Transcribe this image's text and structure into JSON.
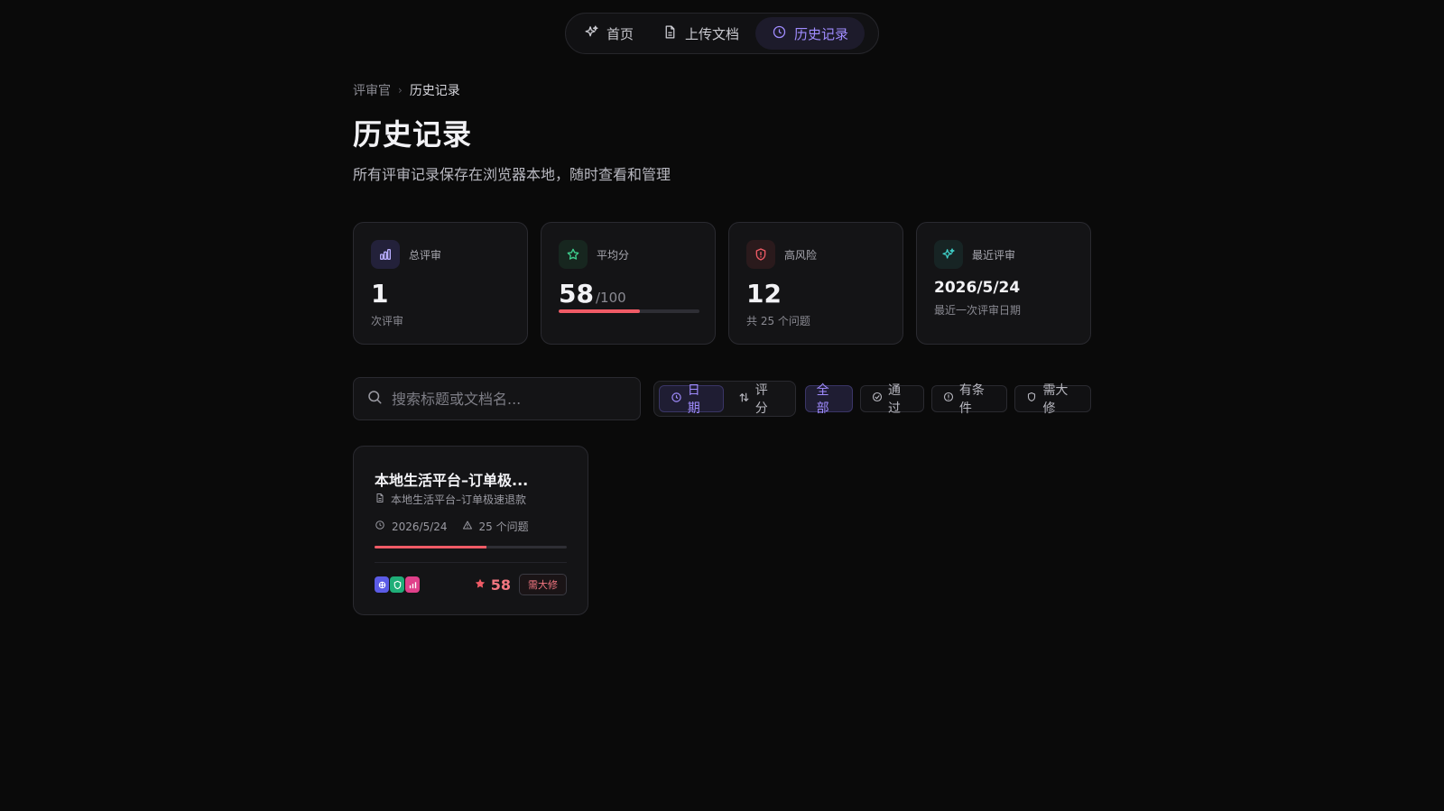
{
  "nav": {
    "items": [
      {
        "label": "首页",
        "icon": "sparkles-icon"
      },
      {
        "label": "上传文档",
        "icon": "document-icon"
      },
      {
        "label": "历史记录",
        "icon": "clock-icon",
        "active": true
      }
    ]
  },
  "breadcrumb": {
    "root": "评审官",
    "separator": "›",
    "current": "历史记录"
  },
  "page": {
    "title": "历史记录",
    "subtitle": "所有评审记录保存在浏览器本地，随时查看和管理"
  },
  "stats": {
    "total": {
      "label": "总评审",
      "value": "1",
      "note": "次评审",
      "icon": "bar-chart-icon"
    },
    "average": {
      "label": "平均分",
      "value": "58",
      "unit": "/100",
      "progress": 0.58,
      "icon": "star-icon"
    },
    "high_risk": {
      "label": "高风险",
      "value": "12",
      "note": "共 25 个问题",
      "icon": "shield-alert-icon"
    },
    "recent": {
      "label": "最近评审",
      "value": "2026/5/24",
      "note": "最近一次评审日期",
      "icon": "sparkles-icon"
    }
  },
  "toolbar": {
    "search_placeholder": "搜索标题或文档名...",
    "sort": [
      {
        "label": "日期",
        "icon": "clock-icon",
        "active": true
      },
      {
        "label": "评分",
        "icon": "sort-icon"
      }
    ],
    "filters": [
      {
        "label": "全部",
        "active": true
      },
      {
        "label": "通过",
        "icon": "check-circle-icon"
      },
      {
        "label": "有条件",
        "icon": "info-circle-icon"
      },
      {
        "label": "需大修",
        "icon": "shield-icon"
      }
    ]
  },
  "records": [
    {
      "title": "本地生活平台–订单极...",
      "file": "本地生活平台–订单极速退款",
      "date": "2026/5/24",
      "issues": "25 个问题",
      "score": "58",
      "score_fraction": 0.58,
      "verdict": "需大修",
      "badges": [
        "brain-icon",
        "shield-icon",
        "bar-chart-icon"
      ]
    }
  ],
  "colors": {
    "accent": "#a08cff",
    "danger": "#f05b66",
    "background": "#0a0a0a",
    "card": "#141416"
  }
}
